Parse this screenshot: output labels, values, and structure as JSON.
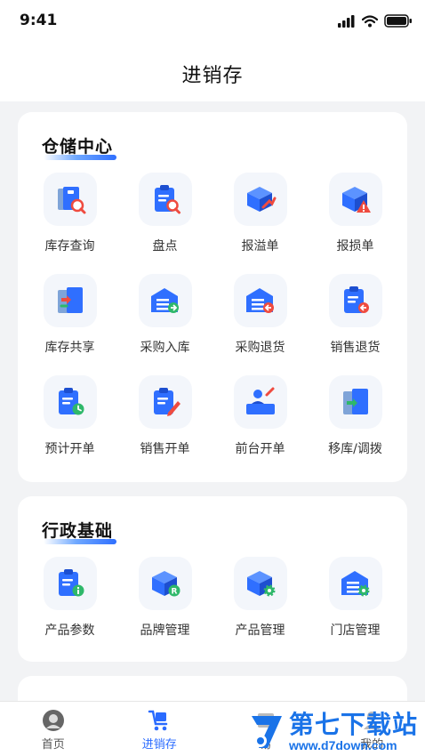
{
  "status": {
    "time": "9:41"
  },
  "header": {
    "title": "进销存"
  },
  "sections": [
    {
      "title": "仓储中心",
      "items": [
        {
          "label": "库存查询",
          "icon": "inventory-search-icon"
        },
        {
          "label": "盘点",
          "icon": "clipboard-search-icon"
        },
        {
          "label": "报溢单",
          "icon": "box-up-icon"
        },
        {
          "label": "报损单",
          "icon": "box-warning-icon"
        },
        {
          "label": "库存共享",
          "icon": "share-doors-icon"
        },
        {
          "label": "采购入库",
          "icon": "warehouse-in-icon"
        },
        {
          "label": "采购退货",
          "icon": "warehouse-return-icon"
        },
        {
          "label": "销售退货",
          "icon": "clipboard-return-icon"
        },
        {
          "label": "预计开单",
          "icon": "clipboard-clock-icon"
        },
        {
          "label": "销售开单",
          "icon": "clipboard-pen-icon"
        },
        {
          "label": "前台开单",
          "icon": "front-desk-icon"
        },
        {
          "label": "移库/调拨",
          "icon": "move-door-icon"
        }
      ]
    },
    {
      "title": "行政基础",
      "items": [
        {
          "label": "产品参数",
          "icon": "clipboard-info-icon"
        },
        {
          "label": "品牌管理",
          "icon": "box-brand-icon"
        },
        {
          "label": "产品管理",
          "icon": "box-gear-icon"
        },
        {
          "label": "门店管理",
          "icon": "store-gear-icon"
        }
      ]
    }
  ],
  "tabbar": [
    {
      "label": "首页",
      "icon": "avatar-home-icon"
    },
    {
      "label": "进销存",
      "icon": "cart-icon",
      "active": true
    },
    {
      "label": "易",
      "icon": "box-icon"
    },
    {
      "label": "我的",
      "icon": "person-icon"
    }
  ],
  "watermark": {
    "main": "第七下载站",
    "sub": "www.d7down.com"
  },
  "colors": {
    "accent": "#2a6bff",
    "icon_blue": "#2f6fff",
    "icon_red": "#ef4b3f",
    "icon_green": "#2fb86a",
    "icon_orange": "#f27a3b"
  }
}
